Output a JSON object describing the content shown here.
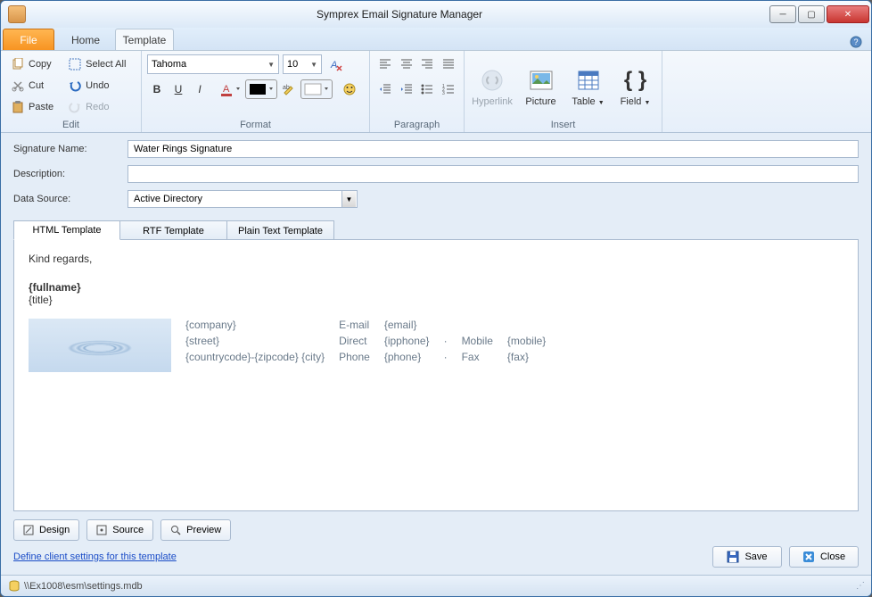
{
  "app": {
    "title": "Symprex Email Signature Manager"
  },
  "tabs": {
    "file": "File",
    "home": "Home",
    "template": "Template"
  },
  "ribbon": {
    "edit": {
      "label": "Edit",
      "copy": "Copy",
      "cut": "Cut",
      "paste": "Paste",
      "selectall": "Select All",
      "undo": "Undo",
      "redo": "Redo"
    },
    "format": {
      "label": "Format",
      "font": "Tahoma",
      "size": "10"
    },
    "paragraph": {
      "label": "Paragraph"
    },
    "insert": {
      "label": "Insert",
      "hyperlink": "Hyperlink",
      "picture": "Picture",
      "table": "Table",
      "field": "Field"
    }
  },
  "form": {
    "sig_label": "Signature Name:",
    "sig_value": "Water Rings Signature",
    "desc_label": "Description:",
    "desc_value": "",
    "ds_label": "Data Source:",
    "ds_value": "Active Directory"
  },
  "ttabs": {
    "html": "HTML Template",
    "rtf": "RTF Template",
    "plain": "Plain Text Template"
  },
  "editor": {
    "greeting": "Kind regards,",
    "fullname": "{fullname}",
    "title": "{title}",
    "col1": {
      "company": "{company}",
      "street": "{street}",
      "city": "{countrycode}-{zipcode} {city}"
    },
    "col2": {
      "l1": "E-mail",
      "l2": "Direct",
      "l3": "Phone"
    },
    "col3": {
      "l1": "{email}",
      "l2": "{ipphone}",
      "l3": "{phone}"
    },
    "col4": {
      "l2": "Mobile",
      "l3": "Fax"
    },
    "col5": {
      "l2": "{mobile}",
      "l3": "{fax}"
    },
    "dot": "·"
  },
  "views": {
    "design": "Design",
    "source": "Source",
    "preview": "Preview"
  },
  "link": "Define client settings for this template",
  "actions": {
    "save": "Save",
    "close": "Close"
  },
  "status": {
    "path": "\\\\Ex1008\\esm\\settings.mdb"
  }
}
